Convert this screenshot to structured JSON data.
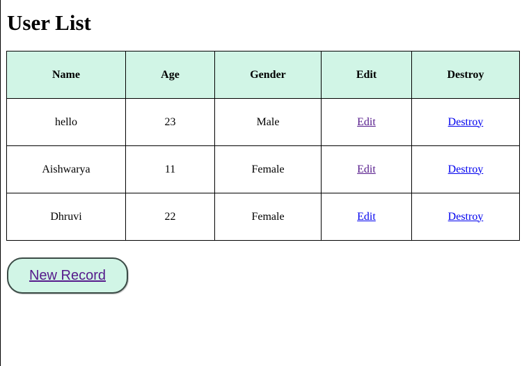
{
  "page": {
    "title": "User List"
  },
  "table": {
    "headers": {
      "name": "Name",
      "age": "Age",
      "gender": "Gender",
      "edit": "Edit",
      "destroy": "Destroy"
    },
    "rows": [
      {
        "name": "hello",
        "age": "23",
        "gender": "Male",
        "edit": "Edit",
        "destroy": "Destroy"
      },
      {
        "name": "Aishwarya",
        "age": "11",
        "gender": "Female",
        "edit": "Edit",
        "destroy": "Destroy"
      },
      {
        "name": "Dhruvi",
        "age": "22",
        "gender": "Female",
        "edit": "Edit",
        "destroy": "Destroy"
      }
    ]
  },
  "actions": {
    "new_record_label": "New Record"
  },
  "colors": {
    "header_bg": "#d1f5e6",
    "link": "#0000ee",
    "visited_link": "#551a8b"
  }
}
